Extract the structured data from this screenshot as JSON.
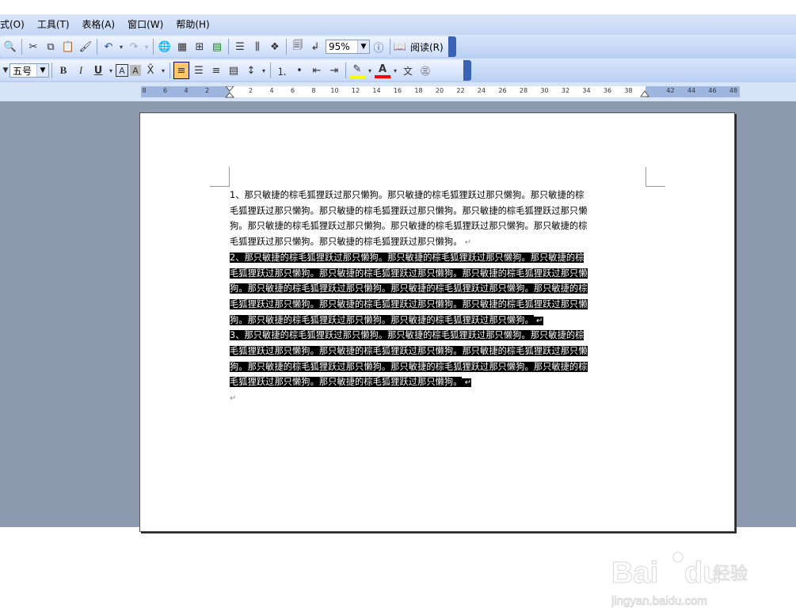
{
  "menu": [
    "式(O)",
    "工具(T)",
    "表格(A)",
    "窗口(W)",
    "帮助(H)"
  ],
  "toolbar": {
    "zoom": "95%",
    "read_label": "阅读(R)",
    "font_size": "五号"
  },
  "ruler": {
    "left_ticks": [
      "8",
      "6",
      "4",
      "2"
    ],
    "right_ticks": [
      "2",
      "4",
      "6",
      "8",
      "10",
      "12",
      "14",
      "16",
      "18",
      "20",
      "22",
      "24",
      "26",
      "28",
      "30",
      "32",
      "34",
      "36",
      "38",
      "",
      "42",
      "44",
      "46",
      "48"
    ]
  },
  "document": {
    "paragraphs": [
      {
        "selected": false,
        "lines": [
          "1、那只敏捷的棕毛狐狸跃过那只懒狗。那只敏捷的棕毛狐狸跃过那只懒狗。那只敏捷的棕",
          "毛狐狸跃过那只懒狗。那只敏捷的棕毛狐狸跃过那只懒狗。那只敏捷的棕毛狐狸跃过那只懒",
          "狗。那只敏捷的棕毛狐狸跃过那只懒狗。那只敏捷的棕毛狐狸跃过那只懒狗。那只敏捷的棕",
          "毛狐狸跃过那只懒狗。那只敏捷的棕毛狐狸跃过那只懒狗。"
        ]
      },
      {
        "selected": true,
        "lines": [
          "2、那只敏捷的棕毛狐狸跃过那只懒狗。那只敏捷的棕毛狐狸跃过那只懒狗。那只敏捷的棕",
          "毛狐狸跃过那只懒狗。那只敏捷的棕毛狐狸跃过那只懒狗。那只敏捷的棕毛狐狸跃过那只懒",
          "狗。那只敏捷的棕毛狐狸跃过那只懒狗。那只敏捷的棕毛狐狸跃过那只懒狗。那只敏捷的棕",
          "毛狐狸跃过那只懒狗。那只敏捷的棕毛狐狸跃过那只懒狗。那只敏捷的棕毛狐狸跃过那只懒",
          "狗。那只敏捷的棕毛狐狸跃过那只懒狗。那只敏捷的棕毛狐狸跃过那只懒狗。"
        ]
      },
      {
        "selected": true,
        "lines": [
          "3、那只敏捷的棕毛狐狸跃过那只懒狗。那只敏捷的棕毛狐狸跃过那只懒狗。那只敏捷的棕",
          "毛狐狸跃过那只懒狗。那只敏捷的棕毛狐狸跃过那只懒狗。那只敏捷的棕毛狐狸跃过那只懒",
          "狗。那只敏捷的棕毛狐狸跃过那只懒狗。那只敏捷的棕毛狐狸跃过那只懒狗。那只敏捷的棕",
          "毛狐狸跃过那只懒狗。那只敏捷的棕毛狐狸跃过那只懒狗。"
        ]
      }
    ],
    "paragraph_mark": "↵"
  },
  "watermark": {
    "brand": "Bai",
    "brand2": "du",
    "cn": "经验",
    "url": "jingyan.baidu.com"
  }
}
